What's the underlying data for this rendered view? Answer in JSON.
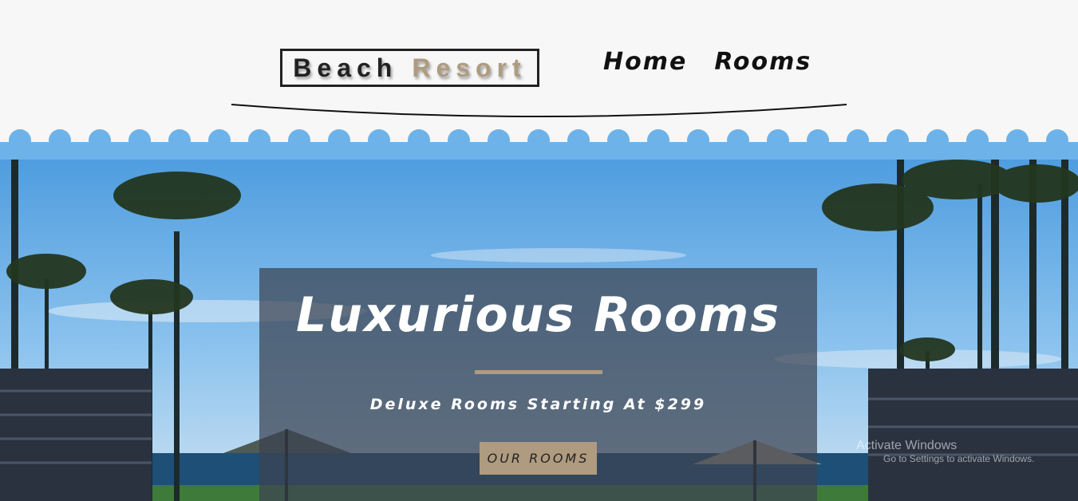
{
  "header": {
    "logo": {
      "word1": "Beach",
      "word2": "Resort"
    },
    "nav": [
      {
        "label": "Home"
      },
      {
        "label": "Rooms"
      }
    ]
  },
  "hero": {
    "title": "Luxurious Rooms",
    "subtitle": "Deluxe Rooms Starting At $299",
    "button_label": "our rooms"
  },
  "watermark": {
    "line1": "Activate Windows",
    "line2": "Go to Settings to activate Windows."
  },
  "colors": {
    "accent": "#af9b7f",
    "wave": "#6db3ea",
    "header_bg": "#f7f7f7",
    "overlay": "#3c4250"
  }
}
